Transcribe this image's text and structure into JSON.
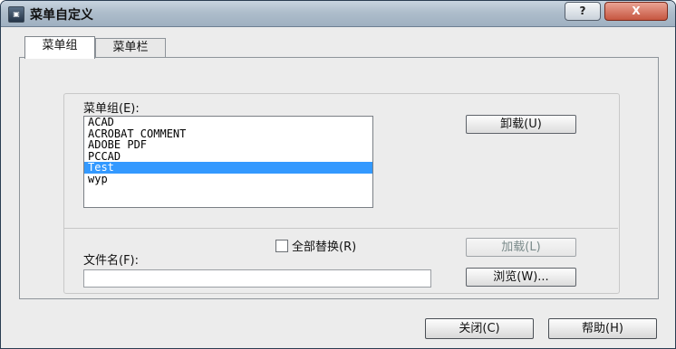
{
  "window": {
    "title": "菜单自定义",
    "help_label": "?",
    "close_symbol": "X"
  },
  "tabs": [
    {
      "label": "菜单组",
      "active": true
    },
    {
      "label": "菜单栏",
      "active": false
    }
  ],
  "menu_groups": {
    "label": "菜单组(E):",
    "items": [
      "ACAD",
      "ACROBAT COMMENT",
      "ADOBE PDF",
      "PCCAD",
      "Test",
      "wyp"
    ],
    "selected": "Test"
  },
  "unload_button": "卸载(U)",
  "replace_all": {
    "label": "全部替换(R)",
    "checked": false
  },
  "load_button": "加载(L)",
  "file_name": {
    "label": "文件名(F):",
    "value": ""
  },
  "browse_button": "浏览(W)...",
  "close_button": "关闭(C)",
  "help_button": "帮助(H)",
  "colors": {
    "selection": "#3399ff",
    "close_button": "#c65640"
  }
}
